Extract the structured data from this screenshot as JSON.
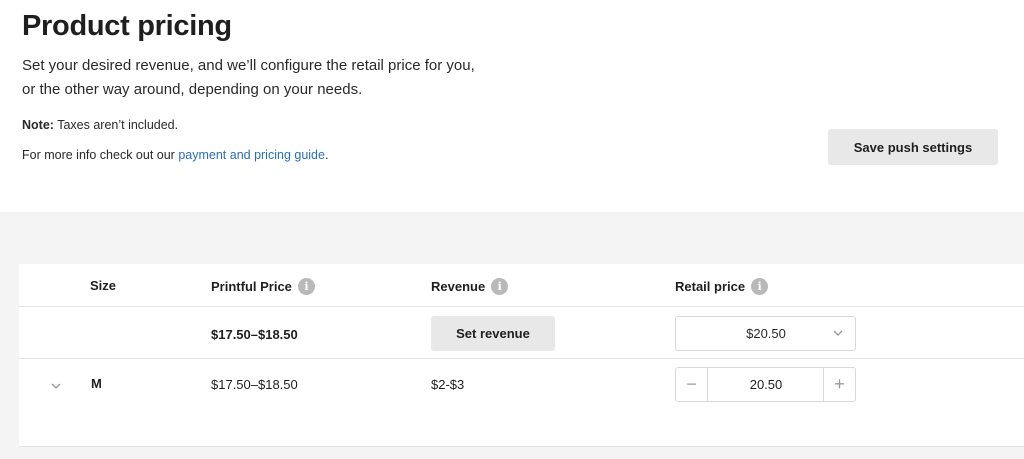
{
  "header": {
    "title": "Product pricing",
    "description": "Set your desired revenue, and we’ll configure the retail price for you, or the other way around, depending on your needs.",
    "note_label": "Note:",
    "note_text": " Taxes aren’t included.",
    "info_prefix": "For more info check out our ",
    "info_link": "payment and pricing guide",
    "info_suffix": ".",
    "save_button": "Save push settings"
  },
  "table": {
    "columns": {
      "size": "Size",
      "printful_price": "Printful Price",
      "revenue": "Revenue",
      "retail_price": "Retail price"
    },
    "summary_row": {
      "printful_price": "$17.50–$18.50",
      "set_revenue_button": "Set revenue",
      "retail_select_value": "$20.50"
    },
    "rows": [
      {
        "size": "M",
        "printful_price": "$17.50–$18.50",
        "revenue": "$2-$3",
        "retail_price": "20.50"
      }
    ]
  },
  "icons": {
    "info": "i"
  },
  "colors": {
    "link": "#2b6fb3",
    "button_bg": "#e8e8e8",
    "page_bg": "#f4f4f4"
  }
}
